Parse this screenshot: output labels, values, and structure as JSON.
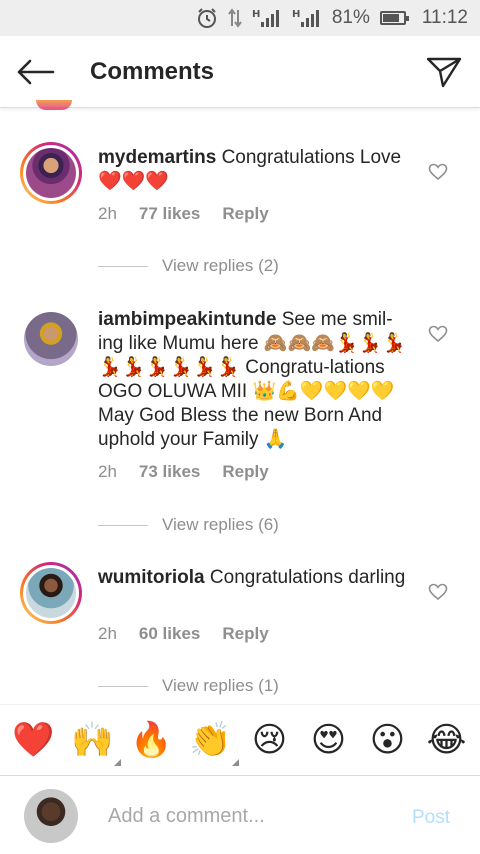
{
  "status_bar": {
    "battery": "81%",
    "battery_level": 0.81,
    "time": "11:12",
    "icons": [
      "alarm-icon",
      "data-arrows-icon",
      "signal-h-icon",
      "signal-h-icon",
      "battery-icon"
    ]
  },
  "header": {
    "back_icon": "arrow-left-icon",
    "title": "Comments",
    "send_icon": "paper-plane-icon"
  },
  "comments": [
    {
      "username": "mydemartins",
      "text": "Congratulations Love ❤️❤️❤️",
      "time": "2h",
      "likes": "77 likes",
      "reply": "Reply",
      "view_replies": "View replies (2)",
      "has_story_ring": true
    },
    {
      "username": "iambimpeakintunde",
      "text": "See me smil-ing like Mumu here 🙈🙈🙈💃💃💃💃💃💃💃💃💃 Congratu-lations OGO OLUWA MII 👑💪💛💛💛💛 May God Bless the new Born And uphold your Family 🙏",
      "time": "2h",
      "likes": "73 likes",
      "reply": "Reply",
      "view_replies": "View replies (6)",
      "has_story_ring": false
    },
    {
      "username": "wumitoriola",
      "text": "Congratulations darling",
      "time": "2h",
      "likes": "60 likes",
      "reply": "Reply",
      "view_replies": "View replies (1)",
      "has_story_ring": true
    }
  ],
  "emoji_bar": [
    {
      "glyph": "❤️",
      "name": "red-heart"
    },
    {
      "glyph": "🙌",
      "name": "raising-hands"
    },
    {
      "glyph": "🔥",
      "name": "fire"
    },
    {
      "glyph": "👏",
      "name": "clapping-hands"
    },
    {
      "glyph": "😢",
      "name": "crying-face"
    },
    {
      "glyph": "😍",
      "name": "heart-eyes"
    },
    {
      "glyph": "😮",
      "name": "surprised-face"
    },
    {
      "glyph": "😂",
      "name": "tears-of-joy"
    }
  ],
  "composer": {
    "placeholder": "Add a comment...",
    "post_label": "Post"
  },
  "colors": {
    "text": "#262626",
    "muted": "#8e8e8e",
    "post_disabled": "#b2dffc",
    "status_bar_bg": "#eeeeee"
  }
}
